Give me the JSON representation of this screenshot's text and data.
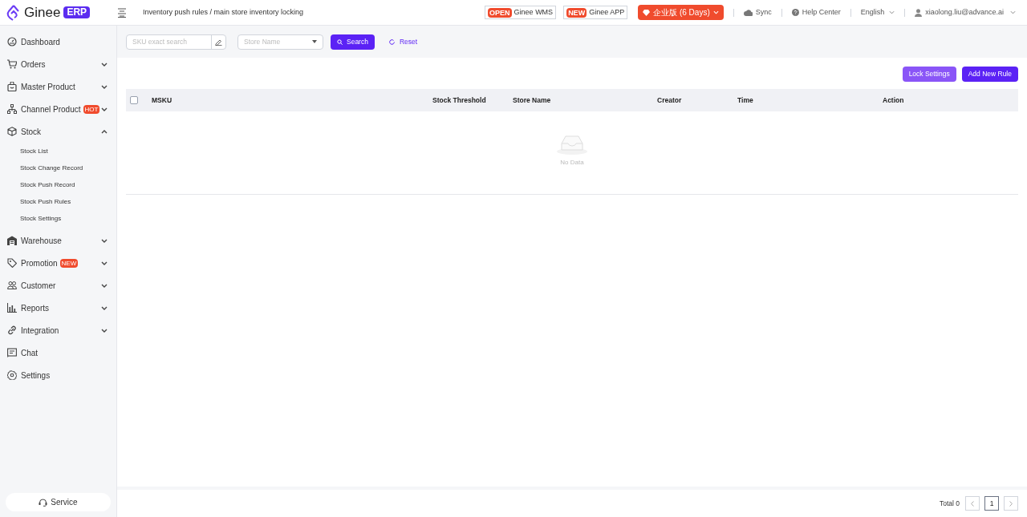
{
  "logo": {
    "name": "Ginee",
    "badge": "ERP"
  },
  "breadcrumb": "Inventory push rules / main store inventory locking",
  "header": {
    "promos": [
      {
        "tag": "OPEN",
        "label": "Ginee WMS"
      },
      {
        "tag": "NEW",
        "label": "Ginee APP"
      }
    ],
    "plan": "企业版 (6 Days)",
    "sync": "Sync",
    "help": "Help Center",
    "language": "English",
    "user": "xiaolong.liu@advance.ai"
  },
  "sidebar": {
    "items": [
      {
        "kind": "link",
        "label": "Dashboard"
      },
      {
        "kind": "group",
        "label": "Orders",
        "expanded": false
      },
      {
        "kind": "group",
        "label": "Master Product",
        "expanded": false
      },
      {
        "kind": "group",
        "label": "Channel Product",
        "badge": "HOT",
        "expanded": false
      },
      {
        "kind": "group",
        "label": "Stock",
        "expanded": true,
        "children": [
          {
            "label": "Stock List"
          },
          {
            "label": "Stock Change Record"
          },
          {
            "label": "Stock Push Record"
          },
          {
            "label": "Stock Push Rules"
          },
          {
            "label": "Stock Settings"
          }
        ]
      },
      {
        "kind": "group",
        "label": "Warehouse",
        "expanded": false
      },
      {
        "kind": "group",
        "label": "Promotion",
        "badge": "NEW",
        "expanded": false
      },
      {
        "kind": "group",
        "label": "Customer",
        "expanded": false
      },
      {
        "kind": "group",
        "label": "Reports",
        "expanded": false
      },
      {
        "kind": "group",
        "label": "Integration",
        "expanded": false
      },
      {
        "kind": "link",
        "label": "Chat"
      },
      {
        "kind": "link",
        "label": "Settings"
      }
    ],
    "service": "Service"
  },
  "filters": {
    "sku_placeholder": "SKU exact search",
    "store_placeholder": "Store Name",
    "search": "Search",
    "reset": "Reset"
  },
  "actions": [
    "Lock Settings",
    "Add New Rule"
  ],
  "table": {
    "columns": [
      "MSKU",
      "Stock Threshold",
      "Store Name",
      "Creator",
      "Time",
      "Action"
    ],
    "select_all": false,
    "empty": "No Data"
  },
  "pagination": {
    "total": "Total 0",
    "pages": [
      {
        "label": "1",
        "selected": true
      }
    ]
  }
}
